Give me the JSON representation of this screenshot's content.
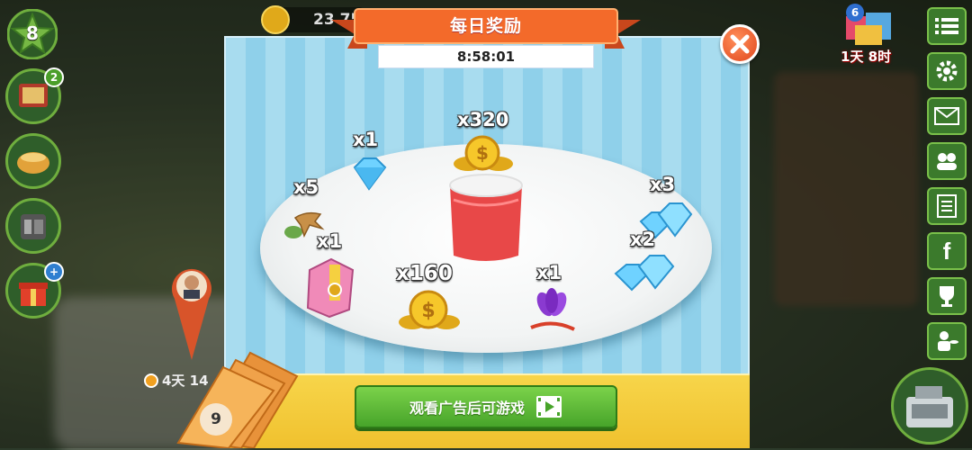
{
  "hud": {
    "level": "8",
    "coins": "23 75",
    "left_buttons": [
      {
        "name": "recipe-book",
        "badge": "2"
      },
      {
        "name": "cooking-pot",
        "badge": ""
      },
      {
        "name": "phone",
        "badge": ""
      },
      {
        "name": "gift",
        "badge": "+"
      }
    ],
    "left_timer": "4天 14",
    "gift_event": {
      "count": "6",
      "time": "1天 8时"
    }
  },
  "dialog": {
    "title": "每日奖励",
    "countdown": "8:58:01",
    "rewards": [
      {
        "item": "diamond",
        "qty": "x1"
      },
      {
        "item": "coins",
        "qty": "x320"
      },
      {
        "item": "ginseng",
        "qty": "x5"
      },
      {
        "item": "diamonds",
        "qty": "x3"
      },
      {
        "item": "tea-bag",
        "qty": "x1"
      },
      {
        "item": "diamonds",
        "qty": "x2"
      },
      {
        "item": "coins",
        "qty": "x160"
      },
      {
        "item": "saffron",
        "qty": "x1"
      }
    ],
    "watch_button": "观看广告后可游戏",
    "tickets": "9"
  },
  "colors": {
    "ribbon": "#f36a2a",
    "button": "#5bb834",
    "bottom_bar": "#f4cb3a",
    "close": "#e8522a"
  }
}
